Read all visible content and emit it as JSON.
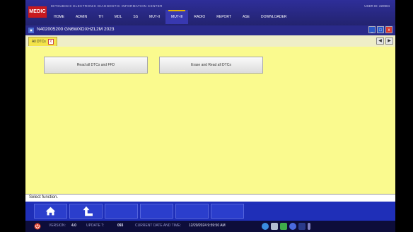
{
  "app": {
    "logo_text": "MEDIC",
    "title": "MITSUBISHI ELECTRONIC DIAGNOSTIC INFORMATION CENTER",
    "user_label": "USER ID:",
    "user_id": "220904"
  },
  "menu": [
    {
      "label": "HOME",
      "active": false
    },
    {
      "label": "ADMIN",
      "active": false
    },
    {
      "label": "TH",
      "active": false
    },
    {
      "label": "MDL",
      "active": false
    },
    {
      "label": "SS",
      "active": false
    },
    {
      "label": "MUT-II",
      "active": false
    },
    {
      "label": "MUT-III",
      "active": true
    },
    {
      "label": "RADIO",
      "active": false
    },
    {
      "label": "REPORT",
      "active": false
    },
    {
      "label": "ASE",
      "active": false
    },
    {
      "label": "DOWNLOADER",
      "active": false
    }
  ],
  "window": {
    "title": "N402005200  GN6WXDXHZL2M 2023",
    "minimize": "_",
    "maximize": "□",
    "close": "x"
  },
  "tab": {
    "label": "All DTCs",
    "close": "x"
  },
  "nav": {
    "prev": "◀",
    "next": "▶"
  },
  "functions": [
    {
      "label": "Read all DTCs and FFD"
    },
    {
      "label": "Erase and Read all DTCs"
    }
  ],
  "status": {
    "text": "Select function."
  },
  "toolbar": {
    "buttons": [
      "home",
      "back",
      "blank",
      "blank",
      "blank",
      "blank"
    ]
  },
  "bottombar": {
    "version_label": "VERSION:",
    "version_value": "4.0",
    "update_label": "UPDATE T:",
    "update_value": "093",
    "date_label": "CURRENT DATE AND TIME:",
    "date_value": "12/20/2024 9:59:50 AM"
  },
  "colors": {
    "content_bg": "#fafa8e",
    "header_bg": "#2e2e99",
    "toolbar_bg": "#1f2fb8",
    "logo_red": "#c8191e",
    "active_accent": "#e6b400"
  }
}
